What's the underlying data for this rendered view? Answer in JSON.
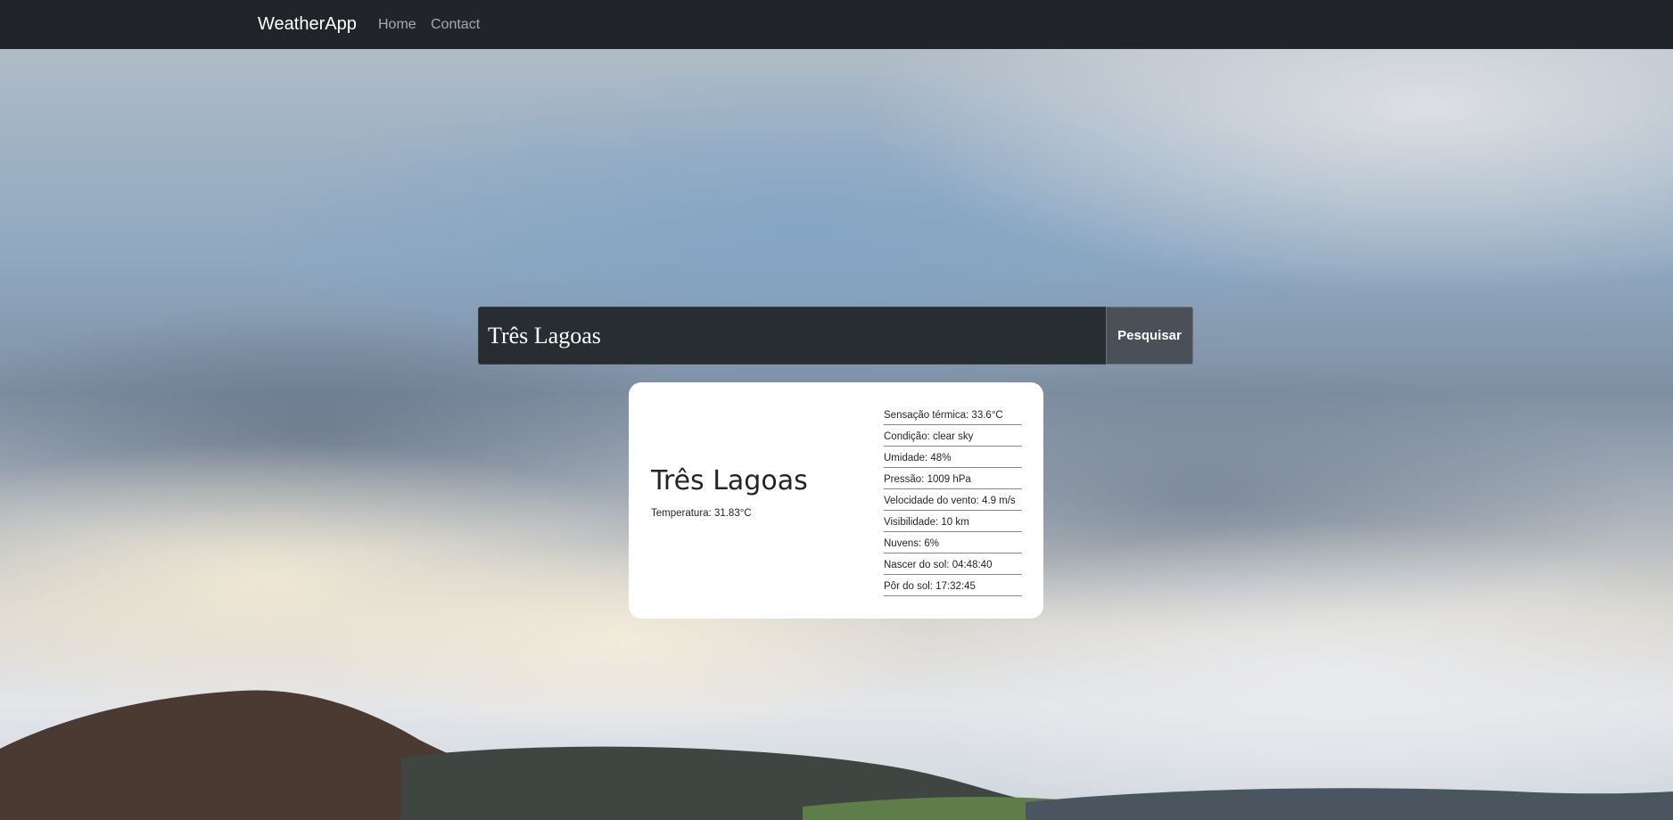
{
  "navbar": {
    "brand": "WeatherApp",
    "links": [
      "Home",
      "Contact"
    ]
  },
  "search": {
    "value": "Três Lagoas",
    "placeholder": "",
    "button_label": "Pesquisar"
  },
  "weather": {
    "city": "Três Lagoas",
    "temperature": "Temperatura: 31.83°C",
    "details": [
      "Sensação térmica: 33.6°C",
      "Condição: clear sky",
      "Umidade: 48%",
      "Pressão: 1009 hPa",
      "Velocidade do vento: 4.9 m/s",
      "Visibilidade: 10 km",
      "Nuvens: 6%",
      "Nascer do sol: 04:48:40",
      "Pôr do sol: 17:32:45"
    ]
  },
  "colors": {
    "navbar": "#212529",
    "card": "#ffffff",
    "button": "#4a4f58"
  }
}
